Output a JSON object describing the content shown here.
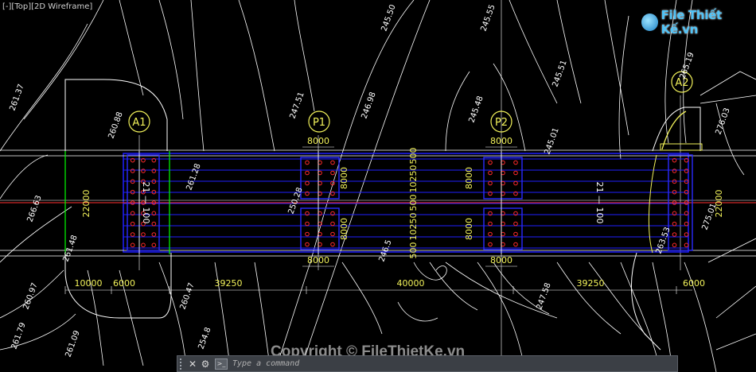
{
  "viewport_label": "[-][Top][2D Wireframe]",
  "logo": {
    "text": "File Thiết Kế.vn"
  },
  "watermark": "Copyright © FileThietKe.vn",
  "command_line": {
    "placeholder": "Type a command",
    "close_label": "✕",
    "options_label": "⚙"
  },
  "colors": {
    "bg": "#000000",
    "line": "#ffffff",
    "label": "#f2f25a",
    "structure": "#1f1fff",
    "bolt": "#ff2a2a",
    "green": "#00ff00",
    "axis": "#ff3030"
  },
  "axis_labels": {
    "a1": "A1",
    "p1": "P1",
    "p2": "P2",
    "a2": "A2"
  },
  "dimensions": {
    "bottom": [
      "10000",
      "6000",
      "39250",
      "40000",
      "39250",
      "6000"
    ],
    "width_left": "22000",
    "width_right": "22000",
    "p1_top": "8000",
    "p1_bottom": "8000",
    "p1_side_top": "8000",
    "p1_side_bottom": "8000",
    "p2_top": "8000",
    "p2_bottom": "8000",
    "p2_side_top": "8000",
    "p2_side_bottom": "8000",
    "mid_stack": [
      "500",
      "10250",
      "500",
      "10250",
      "500"
    ],
    "span_left_text": "21 — 100",
    "span_right_text": "21 — 100"
  },
  "elevations": [
    "261.37",
    "260.88",
    "261.28",
    "266.63",
    "261.48",
    "260.97",
    "260.47",
    "254.8",
    "250.28",
    "247.51",
    "246.98",
    "245.50",
    "245.55",
    "245.48",
    "245.51",
    "245.01",
    "247.58",
    "263.53",
    "261.79",
    "261.09",
    "265.19",
    "275.01",
    "276.03",
    "246.5"
  ]
}
